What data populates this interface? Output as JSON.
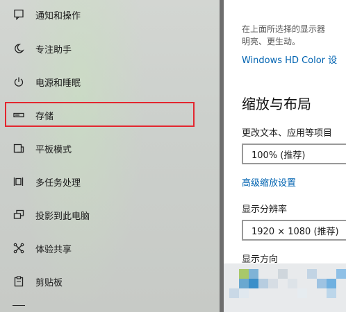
{
  "sidebar": {
    "items": [
      {
        "label": "通知和操作",
        "icon": "notification-icon"
      },
      {
        "label": "专注助手",
        "icon": "moon-icon"
      },
      {
        "label": "电源和睡眠",
        "icon": "power-icon"
      },
      {
        "label": "存储",
        "icon": "storage-icon"
      },
      {
        "label": "平板模式",
        "icon": "tablet-icon"
      },
      {
        "label": "多任务处理",
        "icon": "multitasking-icon"
      },
      {
        "label": "投影到此电脑",
        "icon": "projection-icon"
      },
      {
        "label": "体验共享",
        "icon": "share-icon"
      },
      {
        "label": "剪贴板",
        "icon": "clipboard-icon"
      }
    ],
    "highlight_color": "#e3262f"
  },
  "content": {
    "description_line1": "在上面所选择的显示器",
    "description_line2": "明亮、更生动。",
    "hdr_link": "Windows HD Color 设",
    "section_title": "缩放与布局",
    "scale_label": "更改文本、应用等项目",
    "scale_value": "100% (推荐)",
    "advanced_scaling_link": "高级缩放设置",
    "resolution_label": "显示分辨率",
    "resolution_value": "1920 × 1080 (推荐)",
    "orientation_label": "显示方向",
    "accent_color": "#0063b1"
  }
}
